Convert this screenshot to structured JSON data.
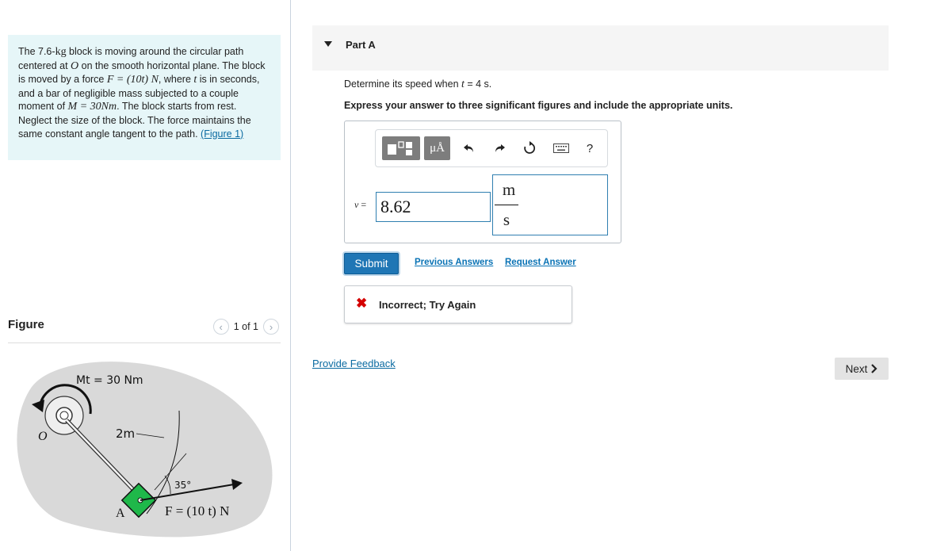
{
  "problem": {
    "t1": "The 7.6-",
    "t1_math": "kg",
    "t2": " block is moving around the circular path centered at ",
    "t2_math": "O",
    "t3": " on the smooth horizontal plane. The block is moved by a force ",
    "force_math": "F = (10t)  N",
    "t4": ", where ",
    "t_math": "t",
    "t5": " is in seconds, and a bar of negligible mass subjected to a couple moment of ",
    "moment_math": "M = 30Nm",
    "t6": ". The block starts from rest. Neglect the size of the block. The force maintains the same constant angle tangent to the path. ",
    "figure_link": "(Figure 1)"
  },
  "figure": {
    "title": "Figure",
    "pager": "1 of 1",
    "label_moment": "Mt = 30 Nm",
    "label_O": "O",
    "label_length": "2m",
    "label_A": "A",
    "label_angle": "35°",
    "label_force": "F = (10 t) N"
  },
  "part": {
    "title": "Part A",
    "question_prefix": "Determine its speed when ",
    "question_var": "t",
    "question_suffix": " = 4 s.",
    "instruction": "Express your answer to three significant figures and include the appropriate units."
  },
  "answer": {
    "var_label": "v",
    "equals": " =",
    "value": "8.62",
    "unit_numerator": "m",
    "unit_denominator": "s",
    "units_button": "μÅ",
    "help": "?"
  },
  "actions": {
    "submit": "Submit",
    "previous_answers": "Previous Answers",
    "request_answer": "Request Answer"
  },
  "feedback": {
    "text": "Incorrect; Try Again"
  },
  "footer": {
    "provide_feedback": "Provide Feedback",
    "next": "Next"
  },
  "colors": {
    "accent": "#1f76b5",
    "error": "#d40000",
    "problem_bg": "#e6f6f8",
    "block": "#1fb84a"
  }
}
